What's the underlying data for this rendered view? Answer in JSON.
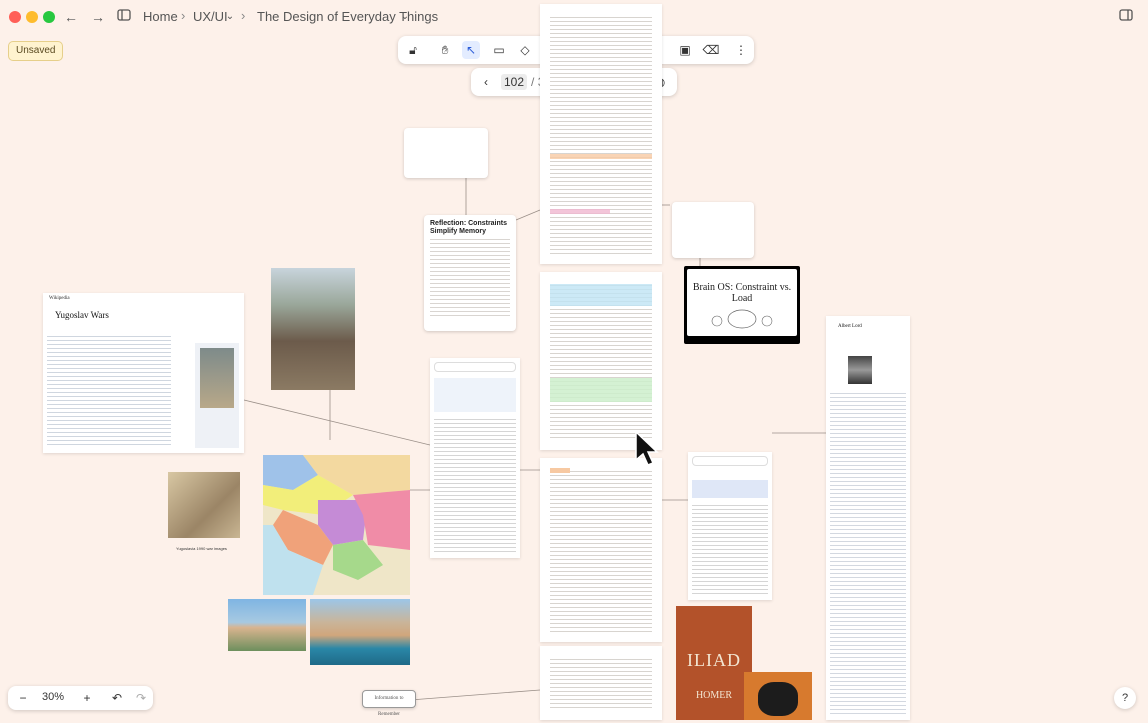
{
  "breadcrumb": {
    "home": "Home",
    "section": "UX/UI",
    "document": "The Design of Everyday Things",
    "separator": "›"
  },
  "status": {
    "unsaved": "Unsaved"
  },
  "pager": {
    "current": "102",
    "separator": "/",
    "total": "369"
  },
  "zoom": {
    "level": "30%",
    "minus": "−",
    "plus": "+"
  },
  "help": {
    "label": "?"
  },
  "notes": {
    "reflection_title": "Reflection: Constraints Simplify Memory",
    "brain_os_title": "Brain OS: Constraint vs. Load",
    "info_to_remember": "Information to Remember"
  },
  "wiki": {
    "yugoslav_title": "Yugoslav Wars",
    "albert_title": "Albert Lord",
    "brand": "Wikipedia"
  },
  "images": {
    "yugoslavia_caption": "Yugoslavia 1990 war images",
    "iliad_title": "ILIAD",
    "iliad_author": "HOMER"
  },
  "colors": {
    "canvas": "#fdf1ea",
    "accent": "#2a5bd7",
    "highlight_orange": "#f7c9a2",
    "highlight_blue": "#bfe3f4",
    "highlight_green": "#cdeecb"
  }
}
